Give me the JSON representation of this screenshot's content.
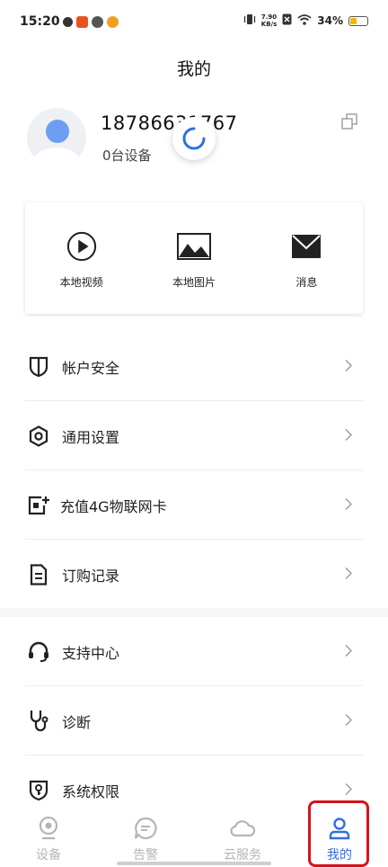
{
  "status_bar": {
    "time": "15:20",
    "speed_value": "7.90",
    "speed_unit": "KB/s",
    "battery": "34%",
    "battery_level": 0.34
  },
  "header": {
    "title": "我的"
  },
  "profile": {
    "user_id": "18786631767",
    "device_count": "0台设备"
  },
  "quick_actions": [
    {
      "label": "本地视频",
      "icon": "play-circle-icon"
    },
    {
      "label": "本地图片",
      "icon": "image-icon"
    },
    {
      "label": "消息",
      "icon": "envelope-icon"
    }
  ],
  "menu_group_1": [
    {
      "label": "帐户安全",
      "icon": "shield-icon"
    },
    {
      "label": "通用设置",
      "icon": "hex-settings-icon"
    },
    {
      "label": "充值4G物联网卡",
      "icon": "sim-card-icon"
    },
    {
      "label": "订购记录",
      "icon": "document-icon"
    }
  ],
  "menu_group_2": [
    {
      "label": "支持中心",
      "icon": "headset-icon"
    },
    {
      "label": "诊断",
      "icon": "stethoscope-icon"
    },
    {
      "label": "系统权限",
      "icon": "permission-shield-icon"
    }
  ],
  "tabs": [
    {
      "label": "设备",
      "icon": "camera-icon",
      "active": false
    },
    {
      "label": "告警",
      "icon": "chat-bubble-icon",
      "active": false
    },
    {
      "label": "云服务",
      "icon": "cloud-icon",
      "active": false
    },
    {
      "label": "我的",
      "icon": "user-icon",
      "active": true
    }
  ],
  "colors": {
    "accent": "#2f6fe0",
    "avatar": "#6e9ef3",
    "highlight": "#d2141c",
    "inactive_tab": "#b5b5b5"
  }
}
